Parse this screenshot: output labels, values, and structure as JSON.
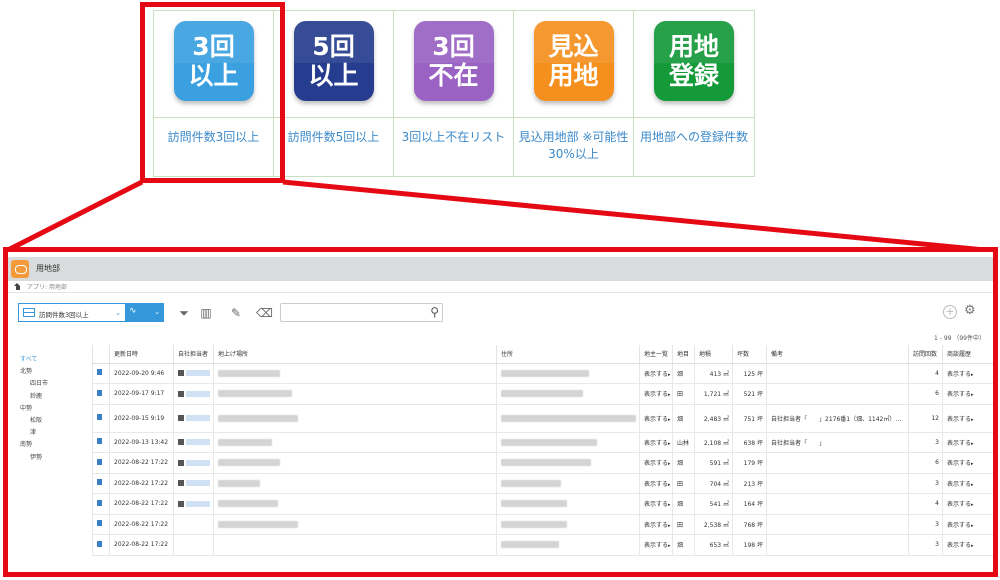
{
  "tiles": [
    {
      "icon_lines": [
        "3回",
        "以上"
      ],
      "color": "#3aa0e0",
      "caption": "訪問件数3回以上"
    },
    {
      "icon_lines": [
        "5回",
        "以上"
      ],
      "color": "#263d8f",
      "caption": "訪問件数5回以上"
    },
    {
      "icon_lines": [
        "3回",
        "不在"
      ],
      "color": "#9a62c3",
      "caption": "3回以上不在リスト"
    },
    {
      "icon_lines": [
        "見込",
        "用地"
      ],
      "color": "#f5901f",
      "caption": "見込用地部 ※可能性30%以上"
    },
    {
      "icon_lines": [
        "用地",
        "登録"
      ],
      "color": "#159a3a",
      "caption": "用地部への登録件数"
    }
  ],
  "highlight_color": "#e50914",
  "app": {
    "title": "用地部",
    "breadcrumb": "アプリ: 用地部",
    "view_select": "訪問件数3回以上",
    "record_count": "1 - 99 （99件中）",
    "sidebar": [
      {
        "label": "すべて",
        "level": 0,
        "active": true
      },
      {
        "label": "北勢",
        "level": 0
      },
      {
        "label": "四日市",
        "level": 1
      },
      {
        "label": "鈴鹿",
        "level": 1
      },
      {
        "label": "中勢",
        "level": 0
      },
      {
        "label": "松阪",
        "level": 1
      },
      {
        "label": "津",
        "level": 1
      },
      {
        "label": "南勢",
        "level": 0
      },
      {
        "label": "伊勢",
        "level": 1
      }
    ],
    "columns": [
      "",
      "更新日時",
      "自社担当者",
      "地上げ場所",
      "住所",
      "地主一覧",
      "地目",
      "地積",
      "坪数",
      "備考",
      "訪問回数",
      "商談履歴"
    ],
    "rows": [
      {
        "date": "2022-09-20 9:46",
        "jimoku": "畑",
        "chiseki": "413 ㎡",
        "tsubo": "125 坪",
        "note": "",
        "visits": "4",
        "show": "表示する",
        "show2": "表示する"
      },
      {
        "date": "2022-09-17 9:17",
        "jimoku": "田",
        "chiseki": "1,721 ㎡",
        "tsubo": "521 坪",
        "note": "",
        "visits": "6",
        "show": "表示する",
        "show2": "表示する"
      },
      {
        "date": "2022-09-15 9:19",
        "jimoku": "畑",
        "chiseki": "2,483 ㎡",
        "tsubo": "751 坪",
        "note": "自社担当者「　　」2176番1（畑、1142㎡）…",
        "visits": "12",
        "show": "表示する",
        "show2": "表示する",
        "tall": true
      },
      {
        "date": "2022-09-13 13:42",
        "jimoku": "山林",
        "chiseki": "2,108 ㎡",
        "tsubo": "638 坪",
        "note": "自社担当者「　　」",
        "visits": "3",
        "show": "表示する",
        "show2": "表示する"
      },
      {
        "date": "2022-08-22 17:22",
        "jimoku": "畑",
        "chiseki": "591 ㎡",
        "tsubo": "179 坪",
        "note": "",
        "visits": "6",
        "show": "表示する",
        "show2": "表示する"
      },
      {
        "date": "2022-08-22 17:22",
        "jimoku": "田",
        "chiseki": "704 ㎡",
        "tsubo": "213 坪",
        "note": "",
        "visits": "3",
        "show": "表示する",
        "show2": "表示する"
      },
      {
        "date": "2022-08-22 17:22",
        "jimoku": "畑",
        "chiseki": "541 ㎡",
        "tsubo": "164 坪",
        "note": "",
        "visits": "4",
        "show": "表示する",
        "show2": "表示する"
      },
      {
        "date": "2022-08-22 17:22",
        "jimoku": "田",
        "chiseki": "2,538 ㎡",
        "tsubo": "768 坪",
        "note": "",
        "visits": "3",
        "show": "表示する",
        "show2": "表示する"
      },
      {
        "date": "2022-08-22 17:22",
        "jimoku": "畑",
        "chiseki": "653 ㎡",
        "tsubo": "198 坪",
        "note": "",
        "visits": "3",
        "show": "表示する",
        "show2": "表示する"
      }
    ]
  }
}
